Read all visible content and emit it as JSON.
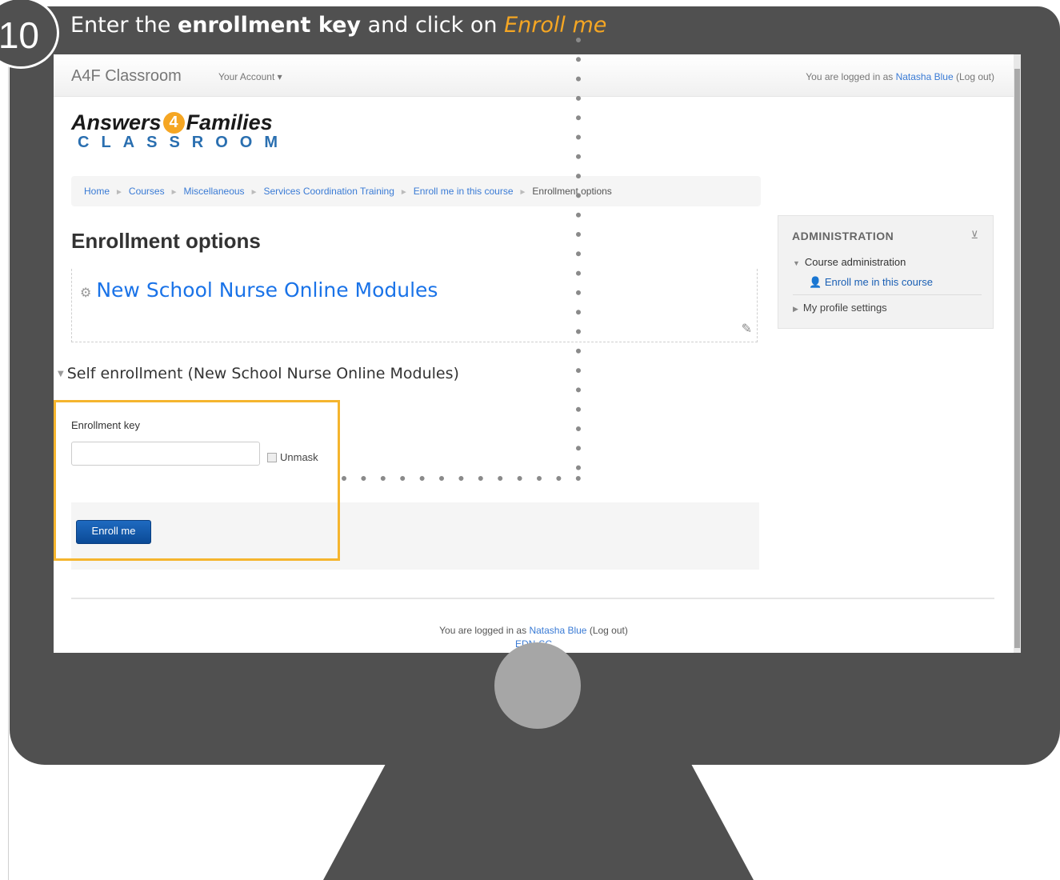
{
  "step": {
    "number": "10",
    "instruction_pre": "Enter the ",
    "instruction_bold": "enrollment key",
    "instruction_mid": " and click on ",
    "instruction_highlight": "Enroll me"
  },
  "navbar": {
    "brand": "A4F Classroom",
    "account_menu": "Your Account",
    "login_prefix": "You are logged in as ",
    "user_name": "Natasha Blue",
    "logout": "(Log out)"
  },
  "logo": {
    "top_left": "Answers",
    "top_mark": "4",
    "top_right": "Families",
    "bottom": "CLASSROOM"
  },
  "breadcrumb": [
    "Home",
    "Courses",
    "Miscellaneous",
    "Services Coordination Training",
    "Enroll me in this course",
    "Enrollment options"
  ],
  "page_title": "Enrollment options",
  "course": {
    "title": "New School Nurse Online Modules"
  },
  "self_enrollment": {
    "heading": "Self enrollment (New School Nurse Online Modules)",
    "key_label": "Enrollment key",
    "key_value": "",
    "unmask_label": "Unmask",
    "submit_label": "Enroll me"
  },
  "administration": {
    "title": "ADMINISTRATION",
    "course_admin": "Course administration",
    "enroll_link": "Enroll me in this course",
    "profile_settings": "My profile settings"
  },
  "footer": {
    "login_prefix": "You are logged in as ",
    "user_name": "Natasha Blue",
    "logout": "(Log out)",
    "site_code": "EDN-SC"
  },
  "colors": {
    "frame": "#505050",
    "highlight": "#f5b52e",
    "accent_orange": "#f5a623",
    "link": "#3a7bd5"
  }
}
